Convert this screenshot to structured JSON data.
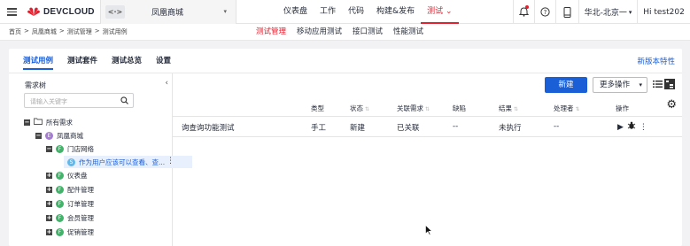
{
  "header": {
    "brand": "DEVCLOUD",
    "project_icon": "<·>",
    "project_name": "凤凰商城",
    "nav": [
      "仪表盘",
      "工作",
      "代码",
      "构建&发布",
      "测试"
    ],
    "active_nav": "测试",
    "region": "华北-北京一",
    "user": "Hi test202"
  },
  "subbar": {
    "breadcrumb": [
      "首页",
      ">",
      "凤凰商城",
      ">",
      "测试管理",
      ">",
      "测试用例"
    ],
    "nav": [
      "测试管理",
      "移动应用测试",
      "接口测试",
      "性能测试"
    ],
    "active": "测试管理"
  },
  "tabs": {
    "items": [
      "测试用例",
      "测试套件",
      "测试总览",
      "设置"
    ],
    "active": "测试用例",
    "new_version": "新版本特性"
  },
  "tree": {
    "title": "需求树",
    "search_placeholder": "请输入关键字",
    "nodes": [
      {
        "label": "所有需求",
        "badge": ""
      },
      {
        "label": "凤凰商城",
        "badge": "E"
      },
      {
        "label": "门店网络",
        "badge": "F"
      },
      {
        "label": "作为用户应该可以查看、查...",
        "badge": "S"
      },
      {
        "label": "仪表盘",
        "badge": "F"
      },
      {
        "label": "配件管理",
        "badge": "F"
      },
      {
        "label": "订单管理",
        "badge": "F"
      },
      {
        "label": "会员管理",
        "badge": "F"
      },
      {
        "label": "促销管理",
        "badge": "F"
      }
    ]
  },
  "toolbar": {
    "new_button": "新建",
    "more_button": "更多操作"
  },
  "table": {
    "headers": [
      "类型",
      "状态",
      "关联需求",
      "缺陷",
      "结果",
      "处理者",
      "操作"
    ],
    "rows": [
      {
        "name": "询查询功能测试",
        "type": "手工",
        "status": "新建",
        "linked": "已关联",
        "defect": "--",
        "result": "未执行",
        "handler": "--"
      }
    ]
  },
  "colors": {
    "accent": "#1a5fd6",
    "brand": "#e3202f"
  }
}
